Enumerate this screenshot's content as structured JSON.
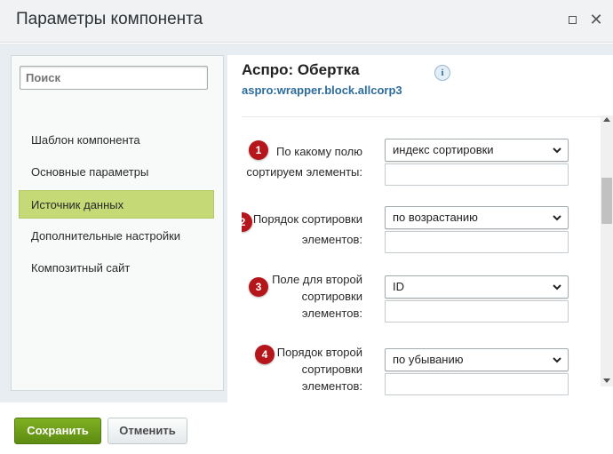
{
  "window": {
    "title": "Параметры компонента",
    "maximize_icon": "maximize-icon",
    "close_icon": "close-icon"
  },
  "sidebar": {
    "search_placeholder": "Поиск",
    "items": [
      {
        "label": "Шаблон компонента",
        "active": false
      },
      {
        "label": "Основные параметры",
        "active": false
      },
      {
        "label": "Источник данных",
        "active": true
      },
      {
        "label": "Дополнительные настройки",
        "active": false
      },
      {
        "label": "Композитный сайт",
        "active": false
      }
    ]
  },
  "component": {
    "title": "Аспро: Обертка",
    "code": "aspro:wrapper.block.allcorp3",
    "info_icon": "i"
  },
  "params": [
    {
      "badge": "1",
      "label_lines": [
        "По какому полю",
        "сортируем элементы:"
      ],
      "value": "индекс сортировки"
    },
    {
      "badge": "2",
      "label_lines": [
        "Порядок сортировки",
        "элементов:"
      ],
      "value": "по возрастанию"
    },
    {
      "badge": "3",
      "label_lines": [
        "Поле для второй",
        "сортировки",
        "элементов:"
      ],
      "value": "ID"
    },
    {
      "badge": "4",
      "label_lines": [
        "Порядок второй",
        "сортировки",
        "элементов:"
      ],
      "value": "по убыванию"
    }
  ],
  "footer": {
    "save_label": "Сохранить",
    "cancel_label": "Отменить"
  },
  "colors": {
    "active_item": "#c5da76",
    "badge": "#b5161c",
    "save_button": "#6b9d1a",
    "code_link": "#2d6d9c"
  }
}
